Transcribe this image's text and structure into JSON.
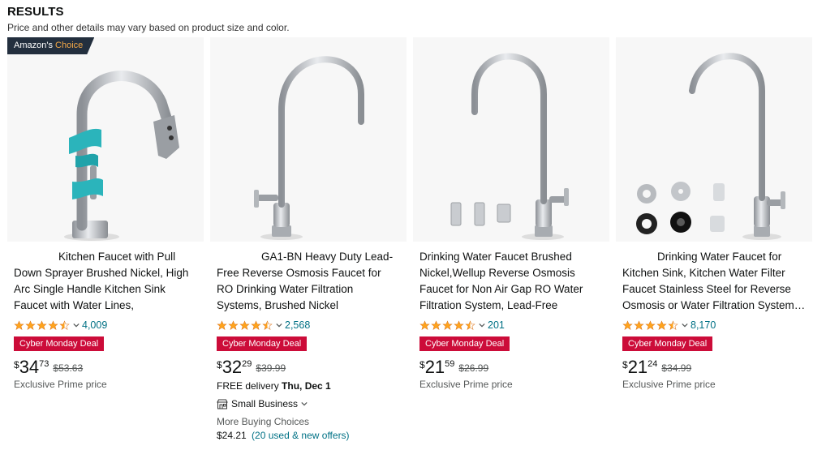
{
  "header": {
    "title": "RESULTS",
    "subtitle": "Price and other details may vary based on product size and color."
  },
  "products": [
    {
      "badge": {
        "prefix": "Amazon's",
        "highlight": "Choice"
      },
      "title": "Kitchen Faucet with Pull Down Sprayer Brushed Nickel, High Arc Single Handle Kitchen Sink Faucet with Water Lines, Commerci…",
      "rating": 4.5,
      "review_count": "4,009",
      "deal": "Cyber Monday Deal",
      "price": {
        "symbol": "$",
        "whole": "34",
        "fraction": "73",
        "list_price": "$53.63"
      },
      "sub_text": "Exclusive Prime price"
    },
    {
      "title": "GA1-BN Heavy Duty Lead-Free Reverse Osmosis Faucet for RO Drinking Water Filtration Systems, Brushed Nickel",
      "rating": 4.5,
      "review_count": "2,568",
      "deal": "Cyber Monday Deal",
      "price": {
        "symbol": "$",
        "whole": "32",
        "fraction": "29",
        "list_price": "$39.99"
      },
      "delivery": {
        "prefix": "FREE delivery",
        "date": "Thu, Dec 1"
      },
      "small_business": "Small Business",
      "more_buying_choices": "More Buying Choices",
      "offers": {
        "price": "$24.21",
        "link": "(20 used & new offers)"
      }
    },
    {
      "title": "Drinking Water Faucet Brushed Nickel,Wellup Reverse Osmosis Faucet for Non Air Gap RO Water Filtration System, Lead-Free Stainle…",
      "rating": 4.5,
      "review_count": "201",
      "deal": "Cyber Monday Deal",
      "price": {
        "symbol": "$",
        "whole": "21",
        "fraction": "59",
        "list_price": "$26.99"
      },
      "sub_text": "Exclusive Prime price"
    },
    {
      "title": "Drinking Water Faucet for Kitchen Sink, Kitchen Water Filter Faucet Stainless Steel for Reverse Osmosis or Water Filtration System…",
      "rating": 4.5,
      "review_count": "8,170",
      "deal": "Cyber Monday Deal",
      "price": {
        "symbol": "$",
        "whole": "21",
        "fraction": "24",
        "list_price": "$34.99"
      },
      "sub_text": "Exclusive Prime price"
    }
  ],
  "colors": {
    "star": "#ffa41c",
    "deal": "#cc0c39",
    "link": "#007185",
    "badge_bg": "#232f3e"
  }
}
